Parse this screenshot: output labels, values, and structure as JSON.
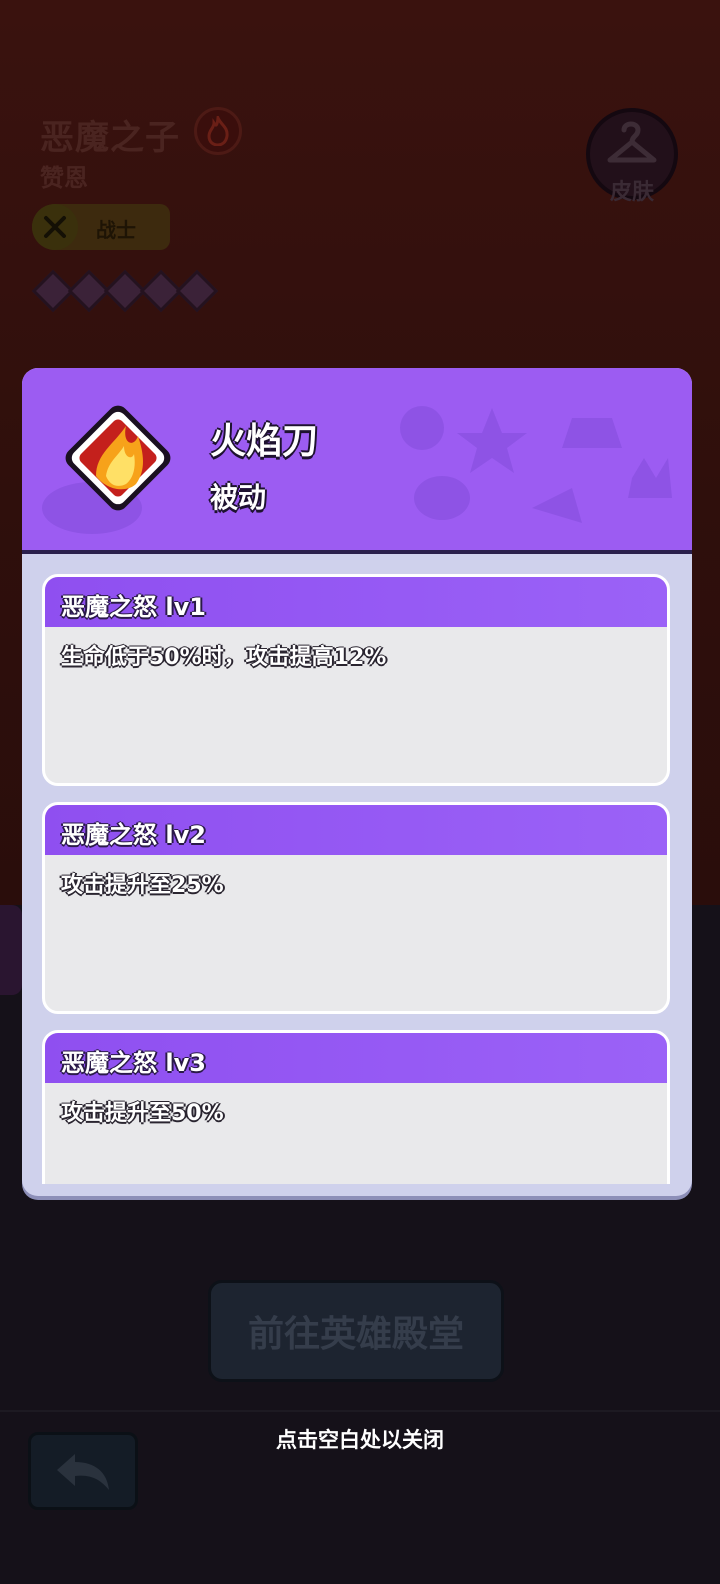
{
  "background": {
    "hero_title": "恶魔之子",
    "hero_name": "赞恩",
    "role_label": "战士",
    "star_count": 5,
    "skin_label": "皮肤",
    "hall_button_label": "前往英雄殿堂",
    "close_hint": "点击空白处以关闭"
  },
  "popup": {
    "skill_name": "火焰刀",
    "skill_type": "被动",
    "levels": [
      {
        "title": "恶魔之怒 lv1",
        "description": "生命低于50%时，攻击提高12%"
      },
      {
        "title": "恶魔之怒 lv2",
        "description": "攻击提升至25%"
      },
      {
        "title": "恶魔之怒 lv3",
        "description": "攻击提升至50%"
      }
    ]
  },
  "icons": {
    "fire_badge": "fire-icon",
    "role": "crossed-swords-icon",
    "skin": "hanger-icon",
    "back": "back-arrow-icon",
    "skill": "flame-blade-icon"
  },
  "colors": {
    "accent_purple": "#9c5cf2",
    "popup_body": "#cfd1ec",
    "card_body": "#e9e9eb"
  }
}
